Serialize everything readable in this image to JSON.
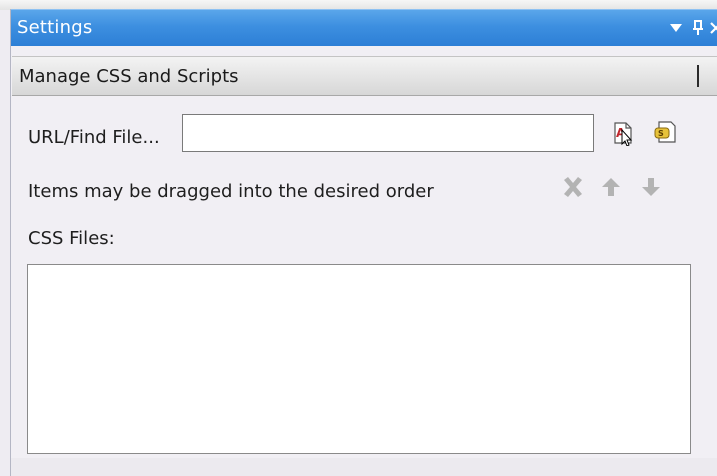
{
  "panel": {
    "title": "Settings",
    "buttons": {
      "dropdown_icon": "chevron-down-icon",
      "pin_icon": "pin-icon",
      "close_icon": "close-icon"
    }
  },
  "section": {
    "header_label": "Manage CSS and Scripts"
  },
  "url_row": {
    "label": "URL/Find File...",
    "input_value": "",
    "input_placeholder": "",
    "buttons": [
      "add-css-file-icon",
      "add-script-file-icon"
    ]
  },
  "info": {
    "text": "Items may be dragged into the desired order",
    "actions": [
      "delete-icon",
      "move-up-icon",
      "move-down-icon"
    ]
  },
  "css_files": {
    "label": "CSS Files:",
    "items": []
  },
  "colors": {
    "titlebar": "#3d8fe0",
    "titlebar_text": "#ffffff",
    "panel_bg": "#f1eff4",
    "disabled_icon": "#b3b3b3"
  }
}
